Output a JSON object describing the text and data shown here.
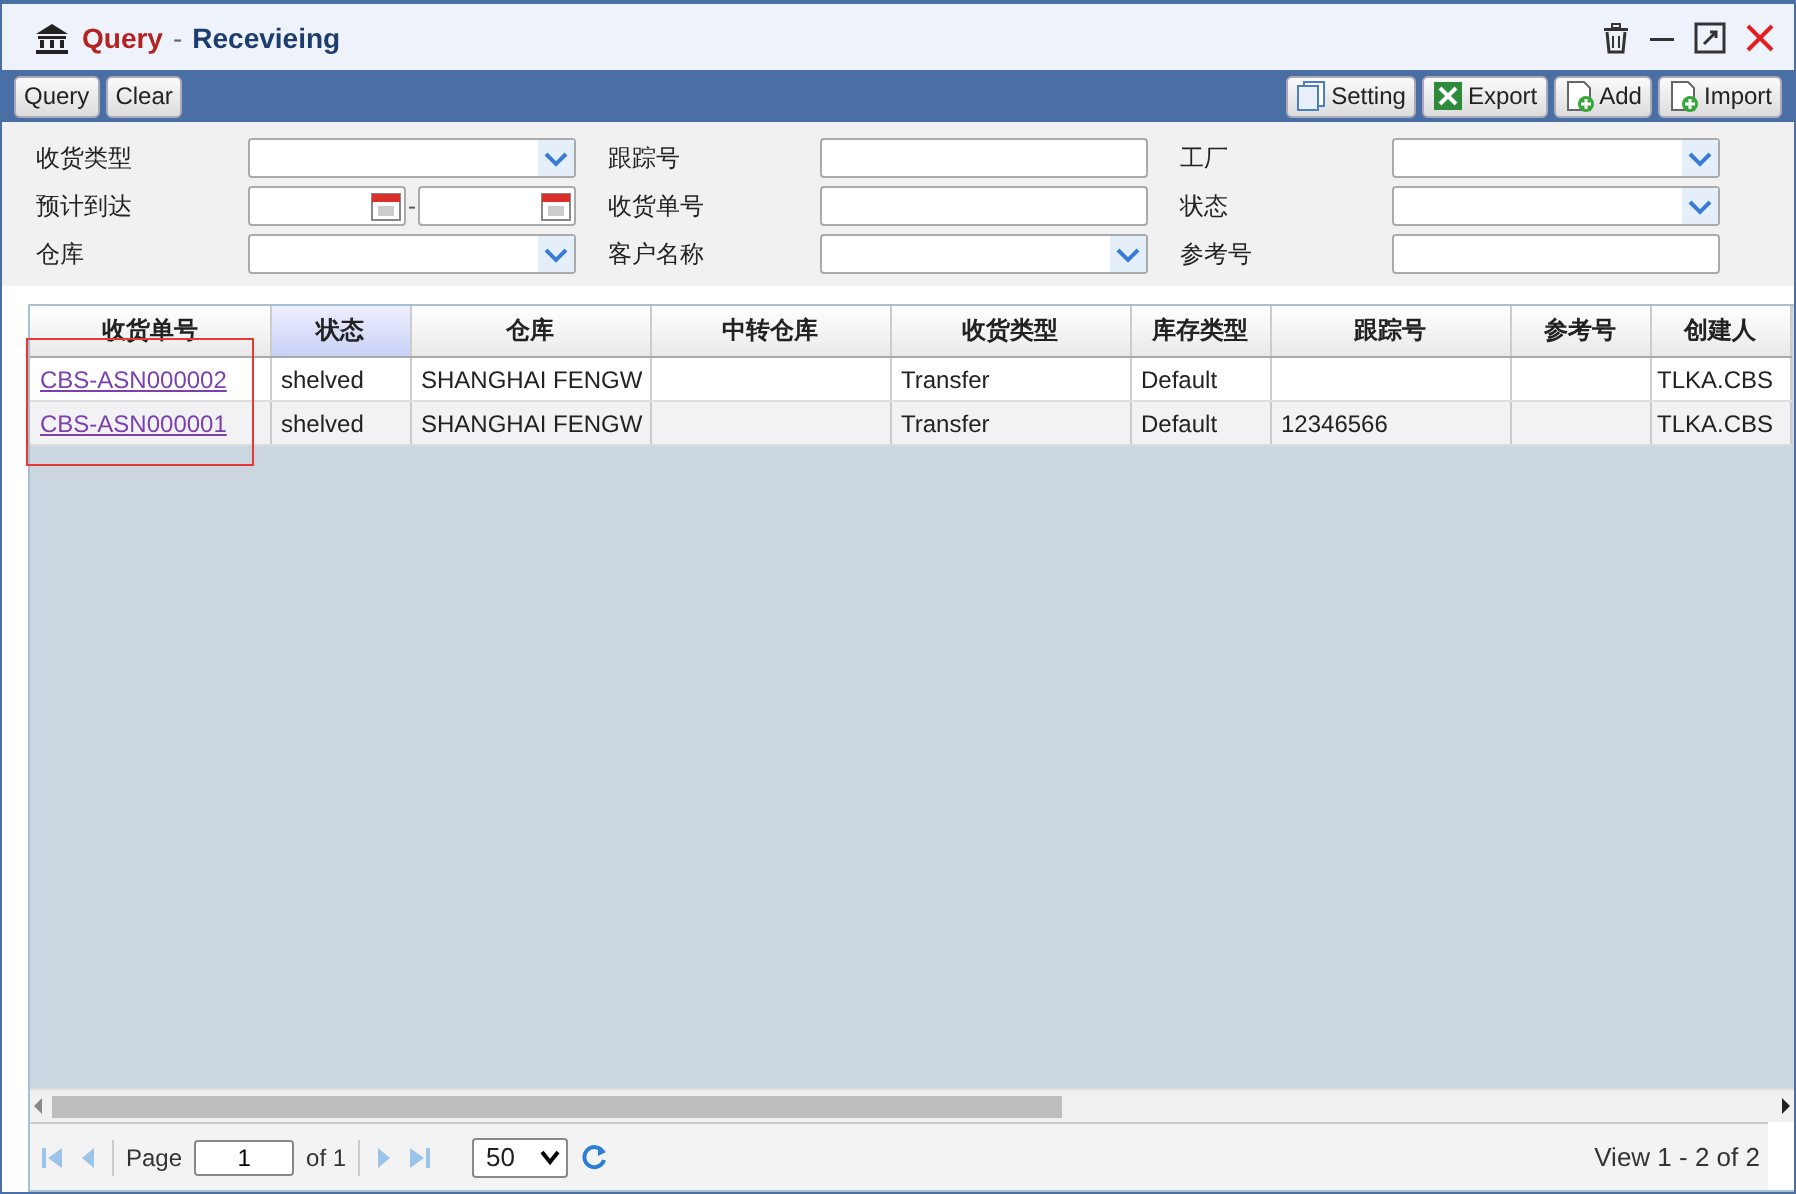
{
  "window": {
    "title_action": "Query",
    "title_separator": "-",
    "title": "Recevieing"
  },
  "toolbar": {
    "left": [
      {
        "label": "Query"
      },
      {
        "label": "Clear"
      }
    ],
    "right": [
      {
        "label": "Setting",
        "kind": "pages"
      },
      {
        "label": "Export",
        "kind": "sheet"
      },
      {
        "label": "Add",
        "kind": "add"
      },
      {
        "label": "Import",
        "kind": "add"
      }
    ]
  },
  "filters": [
    {
      "label": "收货类型",
      "kind": "select"
    },
    {
      "label": "跟踪号",
      "kind": "text"
    },
    {
      "label": "工厂",
      "kind": "select"
    },
    {
      "label": "预计到达",
      "kind": "daterange",
      "separator": "-"
    },
    {
      "label": "收货单号",
      "kind": "text"
    },
    {
      "label": "状态",
      "kind": "select"
    },
    {
      "label": "仓库",
      "kind": "select"
    },
    {
      "label": "客户名称",
      "kind": "select"
    },
    {
      "label": "参考号",
      "kind": "text"
    }
  ],
  "table": {
    "columns": [
      {
        "label": "收货单号",
        "selected": false
      },
      {
        "label": "状态",
        "selected": true
      },
      {
        "label": "仓库",
        "selected": false
      },
      {
        "label": "中转仓库",
        "selected": false
      },
      {
        "label": "收货类型",
        "selected": false
      },
      {
        "label": "库存类型",
        "selected": false
      },
      {
        "label": "跟踪号",
        "selected": false
      },
      {
        "label": "参考号",
        "selected": false
      },
      {
        "label": "创建人",
        "selected": false
      }
    ],
    "rows": [
      [
        "CBS-ASN000002",
        "shelved",
        "SHANGHAI FENGW",
        "",
        "Transfer",
        "Default",
        "",
        "",
        "TLKA.CBS"
      ],
      [
        "CBS-ASN000001",
        "shelved",
        "SHANGHAI FENGW",
        "",
        "Transfer",
        "Default",
        "12346566",
        "",
        "TLKA.CBS"
      ]
    ],
    "annotation_frame": {
      "color": "#e53935"
    }
  },
  "pager": {
    "page_label": "Page",
    "page": "1",
    "of_label": "of 1",
    "page_size": "50",
    "summary": "View 1 - 2 of 2"
  }
}
